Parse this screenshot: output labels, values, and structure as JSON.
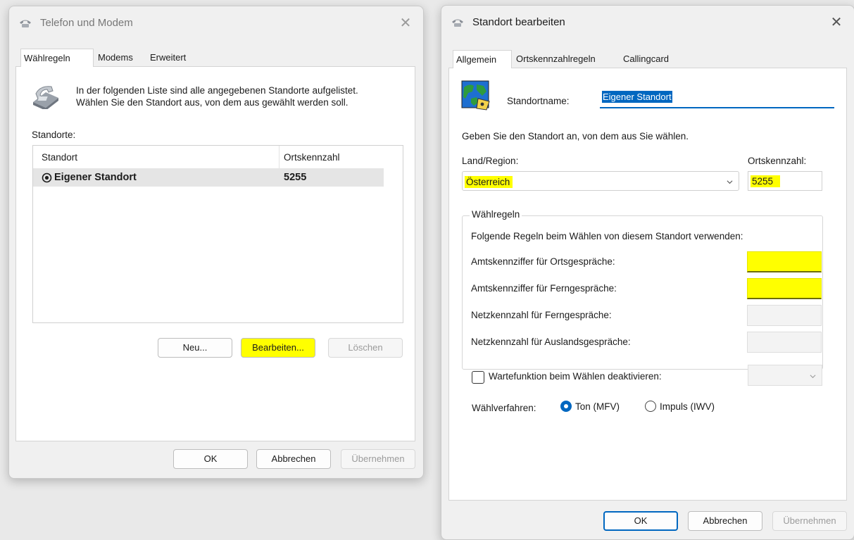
{
  "left_dialog": {
    "title": "Telefon und Modem",
    "close_glyph": "✕",
    "tabs": [
      "Wählregeln",
      "Modems",
      "Erweitert"
    ],
    "description_line1": "In der folgenden Liste sind alle angegebenen Standorte aufgelistet.",
    "description_line2": "Wählen Sie den Standort aus, von dem aus gewählt werden soll.",
    "list_label": "Standorte:",
    "columns": [
      "Standort",
      "Ortskennzahl"
    ],
    "rows": [
      {
        "name": "Eigener Standort",
        "area_code": "5255",
        "selected": true
      }
    ],
    "buttons": {
      "new": "Neu...",
      "edit": "Bearbeiten...",
      "delete": "Löschen"
    },
    "footer": {
      "ok": "OK",
      "cancel": "Abbrechen",
      "apply": "Übernehmen"
    }
  },
  "right_dialog": {
    "title": "Standort bearbeiten",
    "close_glyph": "✕",
    "tabs": [
      "Allgemein",
      "Ortskennzahlregeln",
      "Callingcard"
    ],
    "location_name_label": "Standortname:",
    "location_name_value": "Eigener Standort",
    "instruction": "Geben Sie den Standort an, von dem aus Sie wählen.",
    "country_label": "Land/Region:",
    "country_value": "Österreich",
    "area_code_label": "Ortskennzahl:",
    "area_code_value": "5255",
    "rules_group_title": "Wählregeln",
    "rules_description": "Folgende Regeln beim Wählen von diesem Standort verwenden:",
    "rules": [
      {
        "label": "Amtskennziffer für Ortsgespräche:",
        "value": "",
        "highlighted": true
      },
      {
        "label": "Amtskennziffer für Ferngespräche:",
        "value": "",
        "highlighted": true
      },
      {
        "label": "Netzkennzahl für Ferngespräche:",
        "value": "",
        "highlighted": false
      },
      {
        "label": "Netzkennzahl für Auslandsgespräche:",
        "value": "",
        "highlighted": false
      }
    ],
    "call_waiting_label": "Wartefunktion beim Wählen deaktivieren:",
    "call_waiting_checked": false,
    "dial_method_label": "Wählverfahren:",
    "dial_options": [
      {
        "label": "Ton (MFV)",
        "selected": true
      },
      {
        "label": "Impuls (IWV)",
        "selected": false
      }
    ],
    "footer": {
      "ok": "OK",
      "cancel": "Abbrechen",
      "apply": "Übernehmen"
    }
  },
  "colors": {
    "highlight": "#ffff00",
    "selection": "#0067c0",
    "window_bg": "#f0f0f0"
  }
}
